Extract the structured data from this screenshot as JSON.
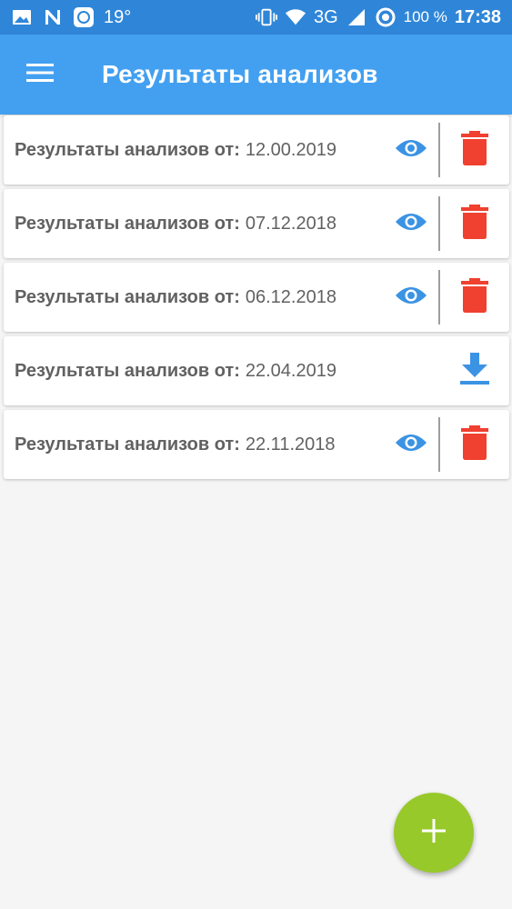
{
  "status_bar": {
    "temperature": "19°",
    "network": "3G",
    "battery": "100 %",
    "time": "17:38",
    "icons": [
      "image-icon",
      "n-icon",
      "app-icon",
      "vibrate-icon",
      "wifi-icon",
      "signal-icon",
      "circle-icon"
    ]
  },
  "app_bar": {
    "title": "Результаты анализов",
    "menu_icon": "hamburger-menu-icon",
    "color": "#43a0f0"
  },
  "results": [
    {
      "label": "Результаты анализов от:",
      "date": "12.00.2019",
      "actions": [
        "view",
        "delete"
      ]
    },
    {
      "label": "Результаты анализов от:",
      "date": "07.12.2018",
      "actions": [
        "view",
        "delete"
      ]
    },
    {
      "label": "Результаты анализов от:",
      "date": "06.12.2018",
      "actions": [
        "view",
        "delete"
      ]
    },
    {
      "label": "Результаты анализов от:",
      "date": "22.04.2019",
      "actions": [
        "download"
      ]
    },
    {
      "label": "Результаты анализов от:",
      "date": "22.11.2018",
      "actions": [
        "view",
        "delete"
      ]
    }
  ],
  "colors": {
    "view_icon": "#3b93e4",
    "delete_icon": "#f0402f",
    "download_icon": "#3b93e4",
    "fab": "#97c92a"
  },
  "fab": {
    "icon": "plus-icon"
  }
}
